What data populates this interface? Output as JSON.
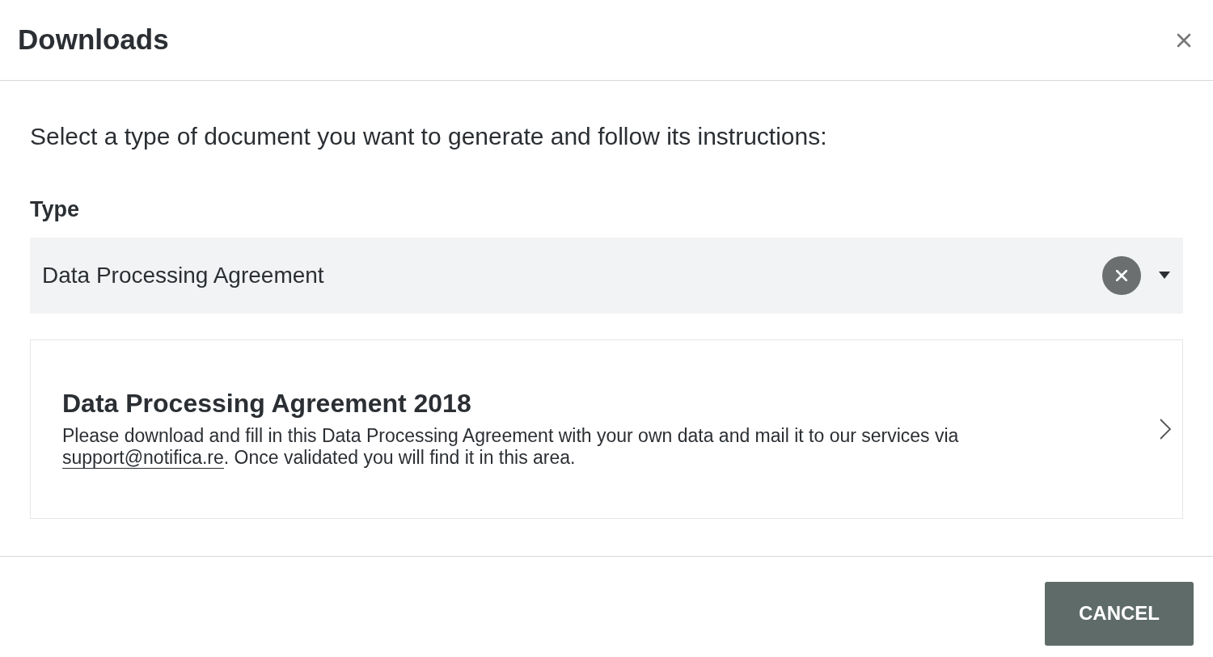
{
  "dialog": {
    "title": "Downloads"
  },
  "intro": "Select a type of document you want to generate and follow its instructions:",
  "type_field": {
    "label": "Type",
    "value": "Data Processing Agreement"
  },
  "documents": [
    {
      "title": "Data Processing Agreement 2018",
      "text_before": "Please download and fill in this Data Processing Agreement with your own data and mail it to our services via ",
      "link": "support@notifica.re",
      "text_after": ". Once validated you will find it in this area."
    }
  ],
  "buttons": [
    "CANCEL"
  ]
}
